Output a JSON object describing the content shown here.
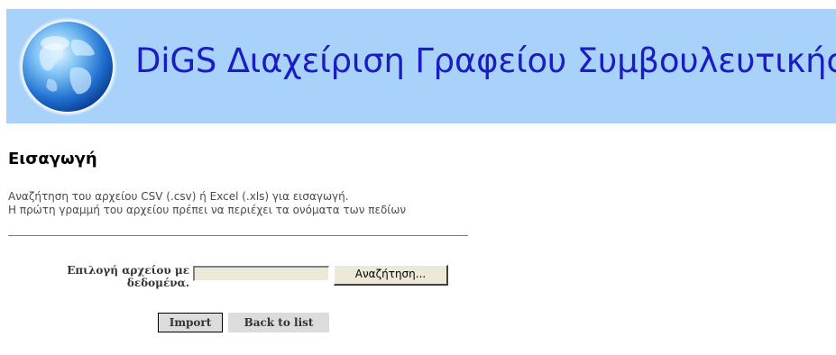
{
  "header": {
    "logo_icon": "globe-icon",
    "title": "DiGS Διαχείριση Γραφείου Συμβουλευτικής",
    "background_color": "#a9d2fb",
    "title_color": "#1c1cc4"
  },
  "page": {
    "title": "Εισαγωγή",
    "description_line1": "Αναζήτηση του αρχείου CSV (.csv) ή Excel (.xls) για εισαγωγή.",
    "description_line2": "Η πρώτη γραμμή του αρχείου πρέπει να περιέχει τα ονόματα των πεδίων"
  },
  "form": {
    "file_label_line1": "Επιλογή αρχείου με",
    "file_label_line2": "δεδομένα.",
    "file_value": "",
    "browse_label": "Αναζήτηση...",
    "import_label": "Import",
    "back_label": "Back to list"
  }
}
